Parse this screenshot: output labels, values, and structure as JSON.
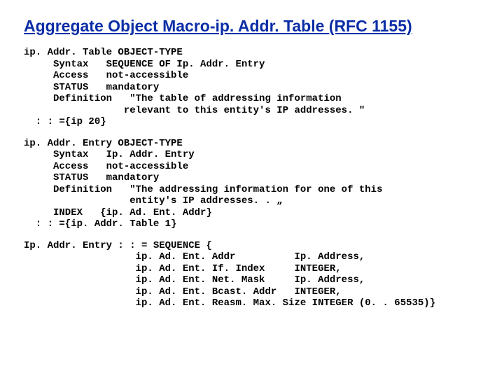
{
  "title": "Aggregate Object Macro-ip. Addr. Table (RFC 1155)",
  "block1": "ip. Addr. Table OBJECT-TYPE\n     Syntax   SEQUENCE OF Ip. Addr. Entry\n     Access   not-accessible\n     STATUS   mandatory\n     Definition   \"The table of addressing information\n                 relevant to this entity's IP addresses. \"\n  : : ={ip 20}",
  "block2": "ip. Addr. Entry OBJECT-TYPE\n     Syntax   Ip. Addr. Entry\n     Access   not-accessible\n     STATUS   mandatory\n     Definition   \"The addressing information for one of this\n                  entity's IP addresses. . „\n     INDEX   {ip. Ad. Ent. Addr}\n  : : ={ip. Addr. Table 1}",
  "block3": "Ip. Addr. Entry : : = SEQUENCE {\n                   ip. Ad. Ent. Addr          Ip. Address,\n                   ip. Ad. Ent. If. Index     INTEGER,\n                   ip. Ad. Ent. Net. Mask     Ip. Address,\n                   ip. Ad. Ent. Bcast. Addr   INTEGER,\n                   ip. Ad. Ent. Reasm. Max. Size INTEGER (0. . 65535)}"
}
